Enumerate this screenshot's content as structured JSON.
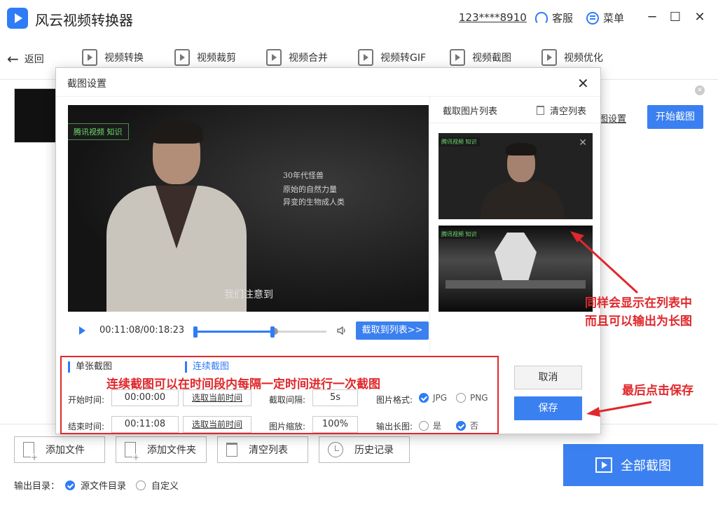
{
  "app": {
    "title": "风云视频转换器",
    "account": "123****8910",
    "service_label": "客服",
    "menu_label": "菜单",
    "minimize": "─",
    "maximize": "☐",
    "close": "✕"
  },
  "toolbar": {
    "back_label": "返回",
    "tools": [
      {
        "label": "视频转换",
        "icon": "video-convert-icon"
      },
      {
        "label": "视频裁剪",
        "icon": "video-crop-icon"
      },
      {
        "label": "视频合并",
        "icon": "video-merge-icon"
      },
      {
        "label": "视频转GIF",
        "icon": "gif-icon"
      },
      {
        "label": "视频截图",
        "icon": "screenshot-icon"
      },
      {
        "label": "视频优化",
        "icon": "optimize-icon"
      }
    ]
  },
  "background": {
    "settings_link": "图设置",
    "start_capture": "开始截图",
    "bottom_buttons": {
      "add_file": "添加文件",
      "add_folder": "添加文件夹",
      "clear_list": "清空列表",
      "history": "历史记录"
    },
    "capture_all": "全部截图",
    "output_label": "输出目录：",
    "output_source": "源文件目录",
    "output_custom": "自定义"
  },
  "modal": {
    "title": "截图设置",
    "close": "✕",
    "video": {
      "badge": "腾讯视频 知识",
      "caption_lines": [
        "30年代怪兽",
        "原始的自然力量",
        "异变的生物成人类"
      ],
      "subtitle": "我们注意到"
    },
    "player": {
      "time": "00:11:08/00:18:23",
      "progress": 0.61,
      "clip_start": 0.0,
      "clip_end": 0.61,
      "add_to_list": "截取到列表>>"
    },
    "list_panel": {
      "title": "截取图片列表",
      "clear": "清空列表",
      "thumb_badge": "腾讯视频 知识"
    },
    "settings": {
      "tab_single": "单张截图",
      "tab_continuous": "连续截图",
      "start_label": "开始时间:",
      "start_value": "00:00:00",
      "pick_current_1": "选取当前时间",
      "interval_label": "截取间隔:",
      "interval_value": "5s",
      "format_label": "图片格式:",
      "format_jpg": "JPG",
      "format_png": "PNG",
      "format_selected": "JPG",
      "end_label": "结束时间:",
      "end_value": "00:11:08",
      "pick_current_2": "选取当前时间",
      "scale_label": "图片缩放:",
      "scale_value": "100%",
      "long_label": "输出长图:",
      "long_yes": "是",
      "long_no": "否",
      "long_selected": "否"
    },
    "cancel": "取消",
    "save": "保存"
  },
  "annotations": {
    "continuous_note": "连续截图可以在时间段内每隔一定时间进行一次截图",
    "list_note_1": "同样会显示在列表中",
    "list_note_2": "而且可以输出为长图",
    "save_note": "最后点击保存"
  },
  "colors": {
    "accent": "#3b80f0",
    "annotation": "#e0282c"
  }
}
